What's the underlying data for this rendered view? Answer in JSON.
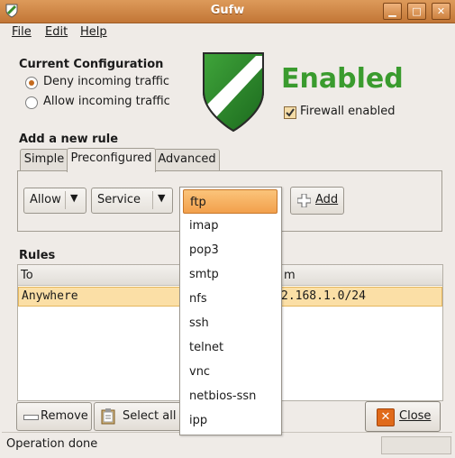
{
  "window": {
    "title": "Gufw"
  },
  "menu": {
    "file": "File",
    "edit": "Edit",
    "help": "Help"
  },
  "config": {
    "heading": "Current Configuration",
    "deny_label": "Deny incoming traffic",
    "allow_label": "Allow incoming traffic",
    "deny_selected": true,
    "status_text": "Enabled",
    "firewall_checkbox_label": "Firewall enabled",
    "firewall_checked": true
  },
  "add_rule": {
    "heading": "Add a new rule",
    "tabs": [
      "Simple",
      "Preconfigured",
      "Advanced"
    ],
    "active_tab": "Preconfigured",
    "action_value": "Allow",
    "type_value": "Service",
    "add_label": "Add"
  },
  "service_dropdown": {
    "selected": "ftp",
    "options": [
      "ftp",
      "imap",
      "pop3",
      "smtp",
      "nfs",
      "ssh",
      "telnet",
      "vnc",
      "netbios-ssn",
      "ipp"
    ]
  },
  "rules": {
    "heading": "Rules",
    "columns": {
      "to": "To",
      "from_partial": "m"
    },
    "rows": [
      {
        "to": "Anywhere",
        "from_partial": "2.168.1.0/24"
      }
    ]
  },
  "buttons": {
    "remove": "Remove",
    "select_all": "Select all",
    "close": "Close"
  },
  "status": {
    "text": "Operation done"
  },
  "colors": {
    "enabled_green": "#3a9b2e",
    "accent_orange": "#c27636",
    "selection": "#fbdfa6"
  }
}
